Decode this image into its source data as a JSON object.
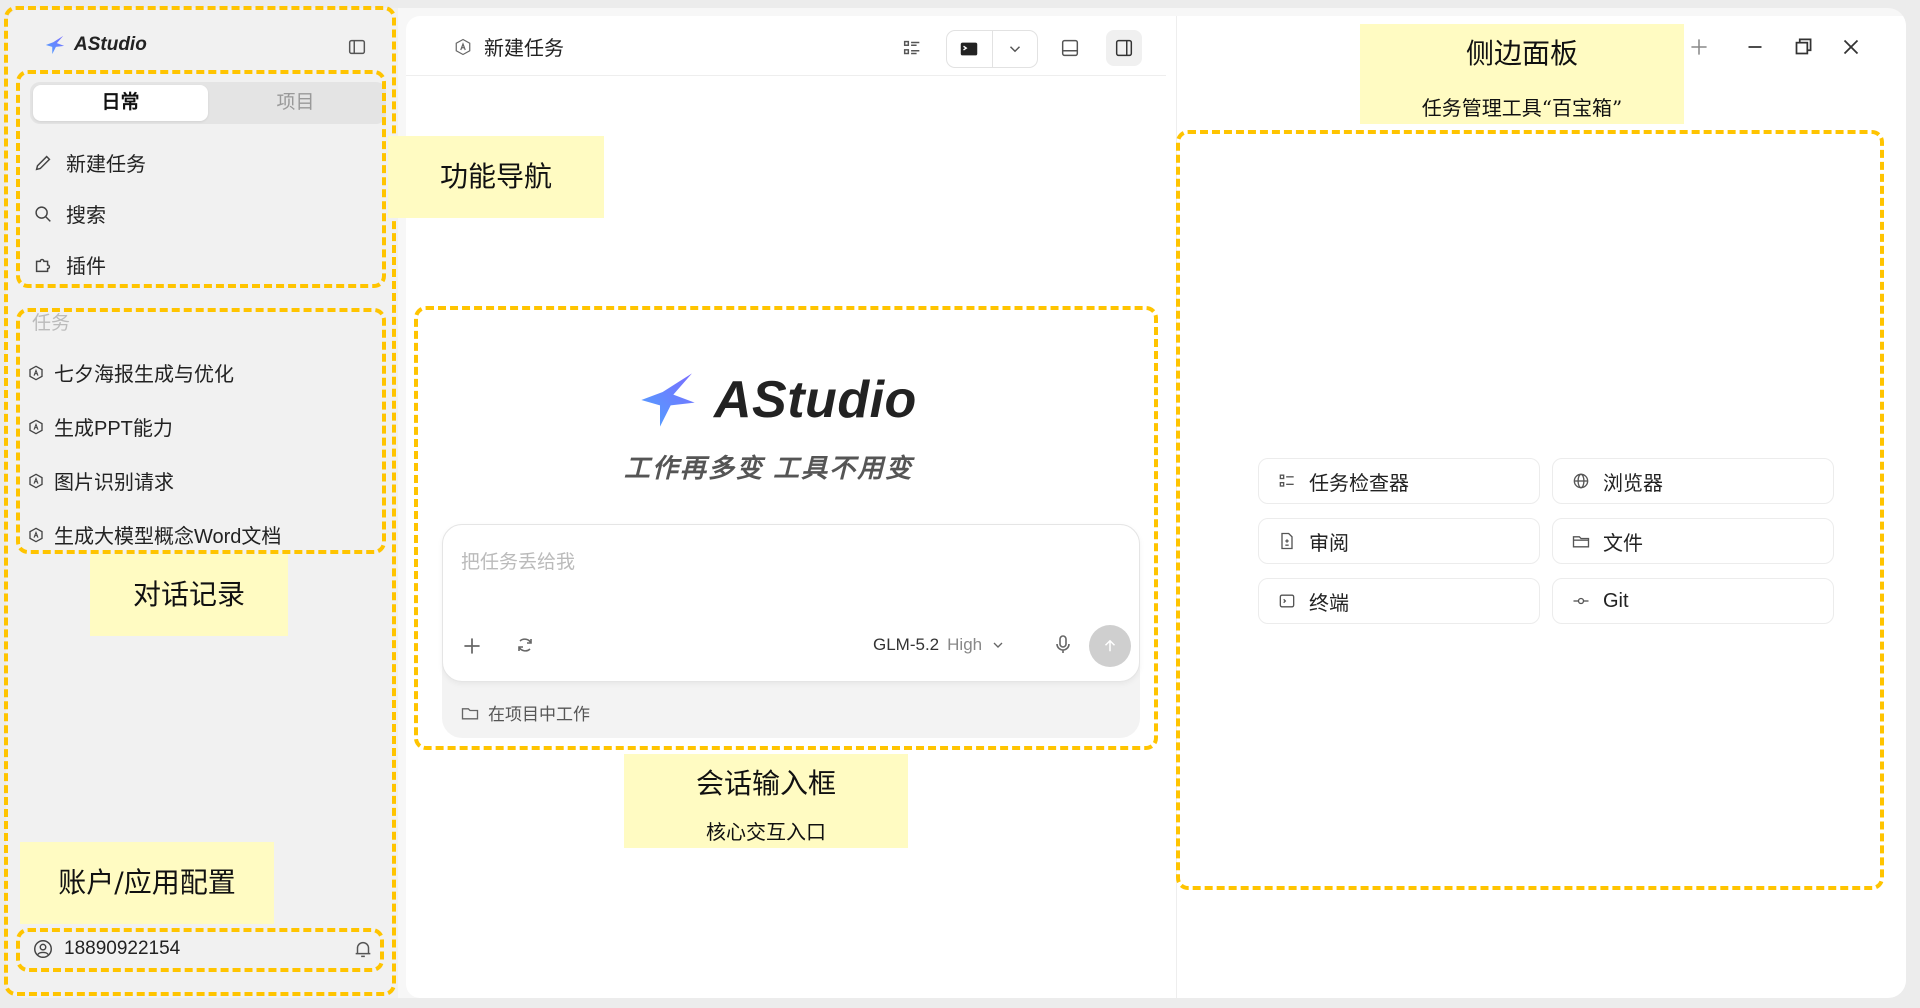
{
  "app": {
    "name": "AStudio",
    "slogan": "工作再多变 工具不用变"
  },
  "sidebar": {
    "tabs": [
      {
        "label": "日常",
        "active": true
      },
      {
        "label": "项目",
        "active": false
      }
    ],
    "nav": [
      {
        "label": "新建任务",
        "icon": "pencil-icon"
      },
      {
        "label": "搜索",
        "icon": "search-icon"
      },
      {
        "label": "插件",
        "icon": "puzzle-icon"
      }
    ],
    "tasks_label": "任务",
    "tasks": [
      {
        "label": "七夕海报生成与优化"
      },
      {
        "label": "生成PPT能力"
      },
      {
        "label": "图片识别请求"
      },
      {
        "label": "生成大模型概念Word文档"
      }
    ],
    "account": {
      "phone": "18890922154"
    }
  },
  "main": {
    "tab_title": "新建任务",
    "input": {
      "placeholder": "把任务丢给我",
      "model": "GLM-5.2",
      "level": "High",
      "project_hint": "在项目中工作"
    }
  },
  "side_panel": {
    "tools": [
      {
        "label": "任务检查器",
        "icon": "list-icon"
      },
      {
        "label": "浏览器",
        "icon": "globe-icon"
      },
      {
        "label": "审阅",
        "icon": "review-doc-icon"
      },
      {
        "label": "文件",
        "icon": "folder-icon"
      },
      {
        "label": "终端",
        "icon": "terminal-icon"
      },
      {
        "label": "Git",
        "icon": "git-commit-icon"
      }
    ]
  },
  "annotations": {
    "nav": "功能导航",
    "history": "对话记录",
    "account": "账户/应用配置",
    "input_title": "会话输入框",
    "input_sub": "核心交互入口",
    "panel_title": "侧边面板",
    "panel_sub": "任务管理工具“百宝箱”"
  },
  "colors": {
    "annotation_border": "#ffc400",
    "annotation_fill": "#fffbc2",
    "brand_gradient": [
      "#7b6cff",
      "#4fa4ff"
    ]
  }
}
